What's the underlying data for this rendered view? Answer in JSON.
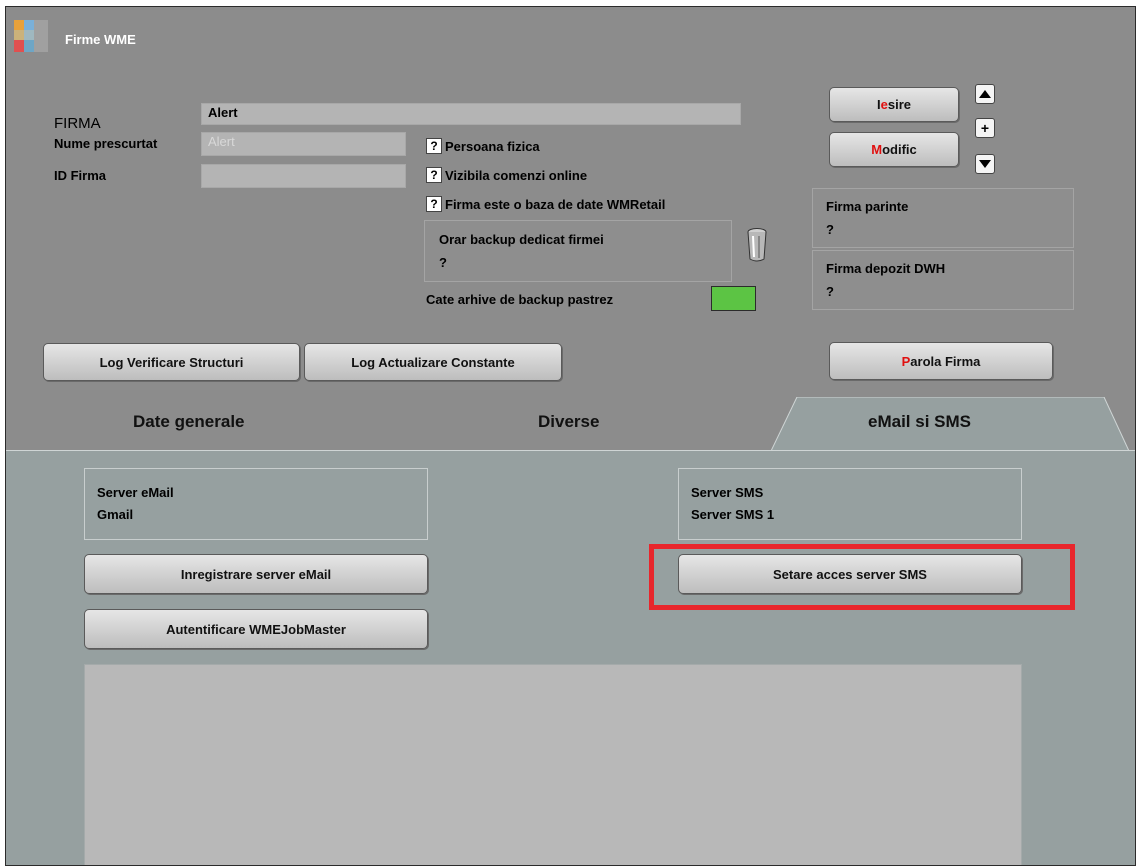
{
  "window": {
    "title": "Firme WME"
  },
  "form": {
    "firma_label": "FIRMA",
    "firma_value": "Alert",
    "nume_prescurtat_label": "Nume prescurtat",
    "nume_prescurtat_value": "Alert",
    "id_firma_label": "ID Firma",
    "id_firma_value": "",
    "persoana_fizica": "Persoana fizica",
    "vizibila_comenzi": "Vizibila comenzi online",
    "firma_baza_date": "Firma este o baza de date WMRetail",
    "question_mark": "?",
    "orar_backup_label": "Orar backup dedicat  firmei",
    "orar_backup_value": "?",
    "arhive_label": "Cate arhive de backup pastrez",
    "firma_parinte_label": "Firma parinte",
    "firma_parinte_value": "?",
    "firma_depozit_label": "Firma depozit DWH",
    "firma_depozit_value": "?"
  },
  "buttons": {
    "iesire_hotkey": "I",
    "iesire_hotkey_2": "e",
    "iesire_rest": "sire",
    "modific_hotkey": "M",
    "modific_rest": "odific",
    "plus": "+",
    "log_verificare": "Log Verificare Structuri",
    "log_actualizare": "Log Actualizare Constante",
    "parola_hotkey": "P",
    "parola_rest": "arola Firma"
  },
  "tabs": [
    {
      "label": "Date generale"
    },
    {
      "label": "Diverse"
    },
    {
      "label": "eMail si SMS",
      "active": true
    }
  ],
  "email_tab": {
    "server_email_label": "Server eMail",
    "server_email_value": "Gmail",
    "server_sms_label": "Server SMS",
    "server_sms_value": "Server SMS 1",
    "inregistrare_button": "Inregistrare server eMail",
    "autentificare_button": "Autentificare WMEJobMaster",
    "setare_sms_button": "Setare acces server SMS"
  },
  "colors": {
    "highlight": "#e8262c",
    "archive_indicator": "#5cc444",
    "hotkey": "#e01010"
  }
}
